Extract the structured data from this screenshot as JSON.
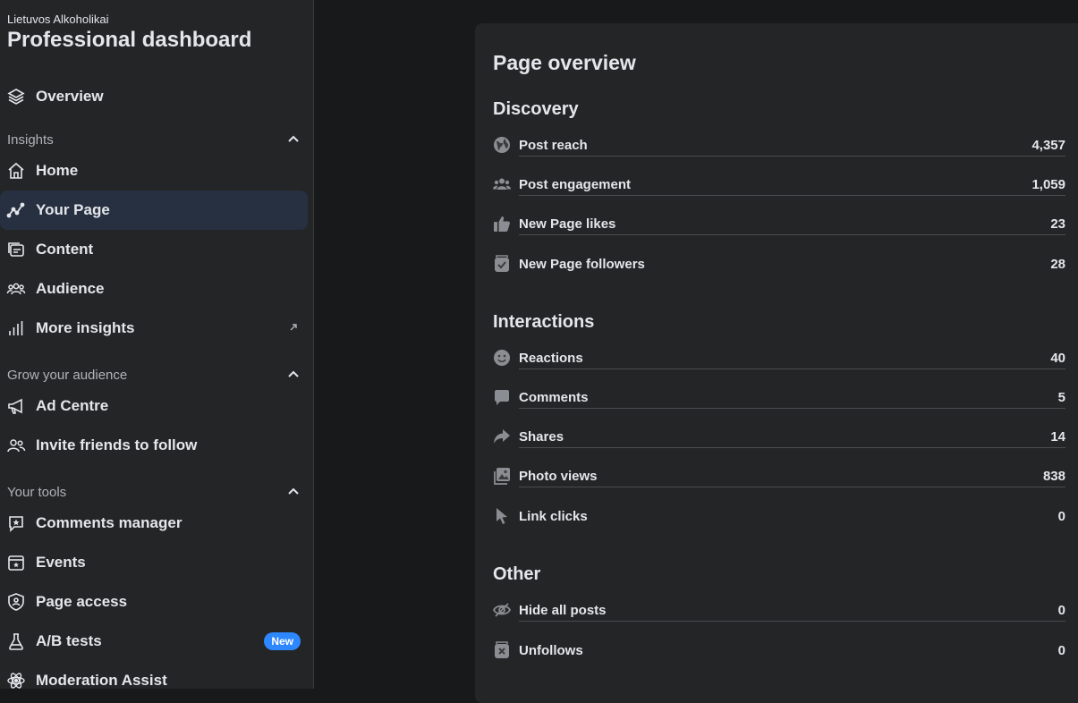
{
  "header": {
    "page_name": "Lietuvos Alkoholikai",
    "title": "Professional dashboard"
  },
  "nav": {
    "overview": "Overview",
    "sections": {
      "insights": "Insights",
      "grow": "Grow your audience",
      "tools": "Your tools"
    },
    "insights_items": [
      {
        "label": "Home"
      },
      {
        "label": "Your Page"
      },
      {
        "label": "Content"
      },
      {
        "label": "Audience"
      },
      {
        "label": "More insights"
      }
    ],
    "grow_items": [
      {
        "label": "Ad Centre"
      },
      {
        "label": "Invite friends to follow"
      }
    ],
    "tools_items": [
      {
        "label": "Comments manager"
      },
      {
        "label": "Events"
      },
      {
        "label": "Page access"
      },
      {
        "label": "A/B tests",
        "badge": "New"
      },
      {
        "label": "Moderation Assist"
      }
    ]
  },
  "overview": {
    "title": "Page overview",
    "discovery": {
      "title": "Discovery",
      "rows": [
        {
          "label": "Post reach",
          "value": "4,357",
          "icon": "globe-icon"
        },
        {
          "label": "Post engagement",
          "value": "1,059",
          "icon": "people-icon"
        },
        {
          "label": "New Page likes",
          "value": "23",
          "icon": "thumbs-up-icon"
        },
        {
          "label": "New Page followers",
          "value": "28",
          "icon": "follow-check-icon"
        }
      ]
    },
    "interactions": {
      "title": "Interactions",
      "rows": [
        {
          "label": "Reactions",
          "value": "40",
          "icon": "smiley-icon"
        },
        {
          "label": "Comments",
          "value": "5",
          "icon": "comment-bubble-icon"
        },
        {
          "label": "Shares",
          "value": "14",
          "icon": "share-arrow-icon"
        },
        {
          "label": "Photo views",
          "value": "838",
          "icon": "photo-icon"
        },
        {
          "label": "Link clicks",
          "value": "0",
          "icon": "cursor-icon"
        }
      ]
    },
    "other": {
      "title": "Other",
      "rows": [
        {
          "label": "Hide all posts",
          "value": "0",
          "icon": "eye-slash-icon"
        },
        {
          "label": "Unfollows",
          "value": "0",
          "icon": "unfollow-x-icon"
        }
      ]
    }
  },
  "colors": {
    "accent": "#2d88ff",
    "active_bg": "#263040",
    "panel_bg": "#242526",
    "page_bg": "#18191a"
  }
}
